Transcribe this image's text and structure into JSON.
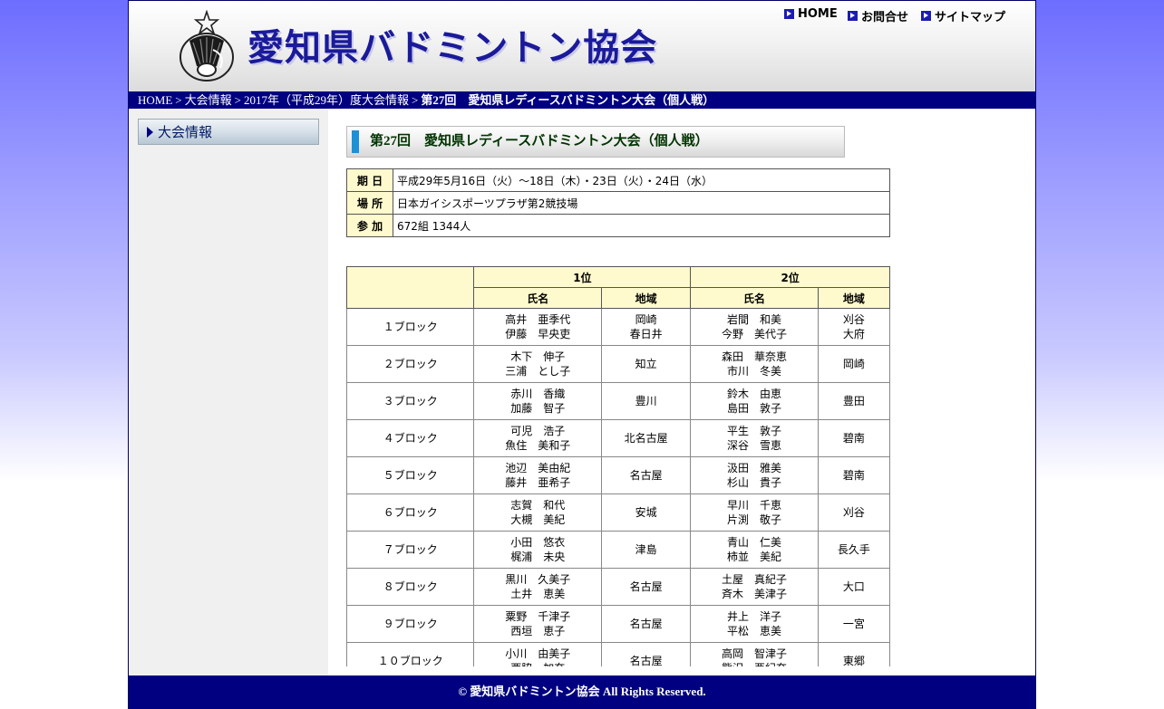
{
  "header": {
    "site_title": "愛知県バドミントン協会",
    "nav": [
      {
        "label": "HOME"
      },
      {
        "label": "お問合せ"
      },
      {
        "label": "サイトマップ"
      }
    ]
  },
  "breadcrumb": {
    "items": [
      "HOME",
      "大会情報",
      "2017年（平成29年）度大会情報"
    ],
    "separator": ">",
    "current": "第27回　愛知県レディースバドミントン大会（個人戦）"
  },
  "sidebar": {
    "items": [
      {
        "label": "大会情報"
      }
    ]
  },
  "main": {
    "heading": "第27回　愛知県レディースバドミントン大会（個人戦）",
    "info": [
      {
        "label": "期 日",
        "value": "平成29年5月16日（火）～18日（木）・23日（火）・24日（水）"
      },
      {
        "label": "場 所",
        "value": "日本ガイシスポーツプラザ第2競技場"
      },
      {
        "label": "参 加",
        "value": "672組 1344人"
      }
    ],
    "results": {
      "place_headers": [
        "1位",
        "2位"
      ],
      "col_headers": [
        "氏名",
        "地域",
        "氏名",
        "地域"
      ],
      "rows": [
        {
          "block": "１ブロック",
          "p1_name1": "高井　亜季代",
          "p1_name2": "伊藤　早央吏",
          "p1_region1": "岡崎",
          "p1_region2": "春日井",
          "p2_name1": "岩間　和美",
          "p2_name2": "今野　美代子",
          "p2_region1": "刈谷",
          "p2_region2": "大府"
        },
        {
          "block": "２ブロック",
          "p1_name1": "木下　伸子",
          "p1_name2": "三浦　とし子",
          "p1_region1": "知立",
          "p1_region2": "",
          "p2_name1": "森田　華奈恵",
          "p2_name2": "市川　冬美",
          "p2_region1": "岡崎",
          "p2_region2": ""
        },
        {
          "block": "３ブロック",
          "p1_name1": "赤川　香織",
          "p1_name2": "加藤　智子",
          "p1_region1": "豊川",
          "p1_region2": "",
          "p2_name1": "鈴木　由恵",
          "p2_name2": "島田　敦子",
          "p2_region1": "豊田",
          "p2_region2": ""
        },
        {
          "block": "４ブロック",
          "p1_name1": "可児　浩子",
          "p1_name2": "魚住　美和子",
          "p1_region1": "北名古屋",
          "p1_region2": "",
          "p2_name1": "平生　敦子",
          "p2_name2": "深谷　雪恵",
          "p2_region1": "碧南",
          "p2_region2": ""
        },
        {
          "block": "５ブロック",
          "p1_name1": "池辺　美由紀",
          "p1_name2": "藤井　亜希子",
          "p1_region1": "名古屋",
          "p1_region2": "",
          "p2_name1": "汲田　雅美",
          "p2_name2": "杉山　貴子",
          "p2_region1": "碧南",
          "p2_region2": ""
        },
        {
          "block": "６ブロック",
          "p1_name1": "志賀　和代",
          "p1_name2": "大槻　美紀",
          "p1_region1": "安城",
          "p1_region2": "",
          "p2_name1": "早川　千恵",
          "p2_name2": "片渕　敬子",
          "p2_region1": "刈谷",
          "p2_region2": ""
        },
        {
          "block": "７ブロック",
          "p1_name1": "小田　悠衣",
          "p1_name2": "梶浦　未央",
          "p1_region1": "津島",
          "p1_region2": "",
          "p2_name1": "青山　仁美",
          "p2_name2": "柿並　美紀",
          "p2_region1": "長久手",
          "p2_region2": ""
        },
        {
          "block": "８ブロック",
          "p1_name1": "黒川　久美子",
          "p1_name2": "土井　恵美",
          "p1_region1": "名古屋",
          "p1_region2": "",
          "p2_name1": "土屋　真紀子",
          "p2_name2": "斉木　美津子",
          "p2_region1": "大口",
          "p2_region2": ""
        },
        {
          "block": "９ブロック",
          "p1_name1": "粟野　千津子",
          "p1_name2": "西垣　恵子",
          "p1_region1": "名古屋",
          "p1_region2": "",
          "p2_name1": "井上　洋子",
          "p2_name2": "平松　恵美",
          "p2_region1": "一宮",
          "p2_region2": ""
        },
        {
          "block": "１０ブロック",
          "p1_name1": "小川　由美子",
          "p1_name2": "西脇　加奈",
          "p1_region1": "名古屋",
          "p1_region2": "",
          "p2_name1": "高岡　智津子",
          "p2_name2": "熊沢　亜紀奈",
          "p2_region1": "東郷",
          "p2_region2": ""
        }
      ]
    }
  },
  "footer": {
    "copyright": "© 愛知県バドミントン協会 All Rights Reserved."
  },
  "colors": {
    "nav_bar": "#000080",
    "table_header_bg": "#fffacd",
    "heading_accent": "#1e90d6"
  }
}
